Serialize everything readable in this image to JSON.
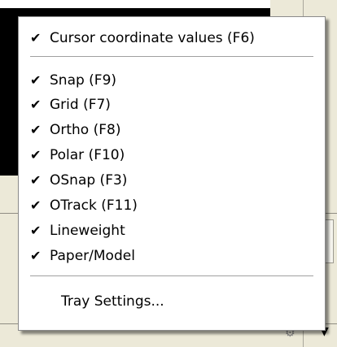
{
  "menu": {
    "items": [
      {
        "label": "Cursor coordinate values (F6)",
        "checked": true
      },
      {
        "label": "Snap (F9)",
        "checked": true
      },
      {
        "label": "Grid (F7)",
        "checked": true
      },
      {
        "label": "Ortho (F8)",
        "checked": true
      },
      {
        "label": "Polar (F10)",
        "checked": true
      },
      {
        "label": "OSnap (F3)",
        "checked": true
      },
      {
        "label": "OTrack (F11)",
        "checked": true
      },
      {
        "label": "Lineweight",
        "checked": true
      },
      {
        "label": "Paper/Model",
        "checked": true
      },
      {
        "label": "Tray Settings...",
        "checked": false
      }
    ],
    "check_glyph": "✔"
  },
  "colors": {
    "menu_background": "#ffffff",
    "menu_border": "#8a8a8a",
    "background_panel": "#ece9d8",
    "background_black": "#000000"
  }
}
